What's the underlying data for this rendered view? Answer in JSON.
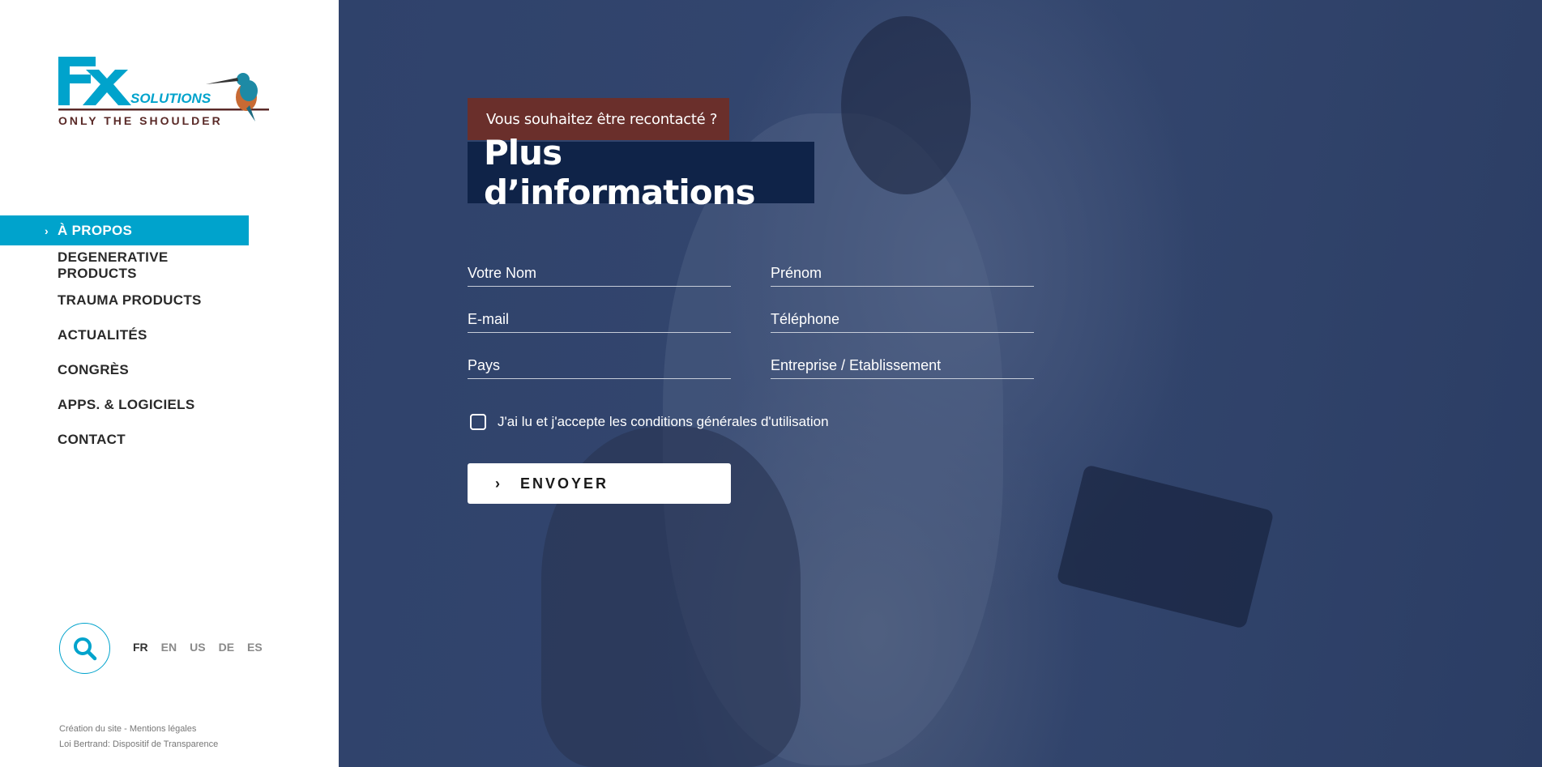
{
  "logo": {
    "text_main": "FX",
    "text_sub": "SOLUTIONS",
    "tagline": "ONLY THE SHOULDER",
    "brand_color": "#00a3cc",
    "tagline_color": "#5a2a28"
  },
  "nav": {
    "items": [
      {
        "label": "À PROPOS",
        "active": true
      },
      {
        "label": "DEGENERATIVE PRODUCTS"
      },
      {
        "label": "TRAUMA PRODUCTS"
      },
      {
        "label": "ACTUALITÉS"
      },
      {
        "label": "CONGRÈS"
      },
      {
        "label": "APPS. & LOGICIELS"
      },
      {
        "label": "CONTACT"
      }
    ]
  },
  "languages": [
    {
      "code": "FR",
      "current": true
    },
    {
      "code": "EN"
    },
    {
      "code": "US"
    },
    {
      "code": "DE"
    },
    {
      "code": "ES"
    }
  ],
  "footer": {
    "line1": "Création du site - Mentions légales",
    "line2": "Loi Bertrand: Dispositif de Transparence"
  },
  "form": {
    "badge": "Vous souhaitez être recontacté ?",
    "title": "Plus d’informations",
    "fields": [
      {
        "placeholder": "Votre Nom"
      },
      {
        "placeholder": "Prénom"
      },
      {
        "placeholder": "E-mail"
      },
      {
        "placeholder": "Téléphone"
      },
      {
        "placeholder": "Pays"
      },
      {
        "placeholder": "Entreprise / Etablissement"
      }
    ],
    "consent": "J'ai lu et j'accepte les conditions générales d'utilisation",
    "submit": "ENVOYER"
  },
  "colors": {
    "accent": "#00a3cc",
    "badge_bg": "#6a2f2b",
    "title_bg": "#0f2348",
    "overlay": "#2f426b"
  }
}
